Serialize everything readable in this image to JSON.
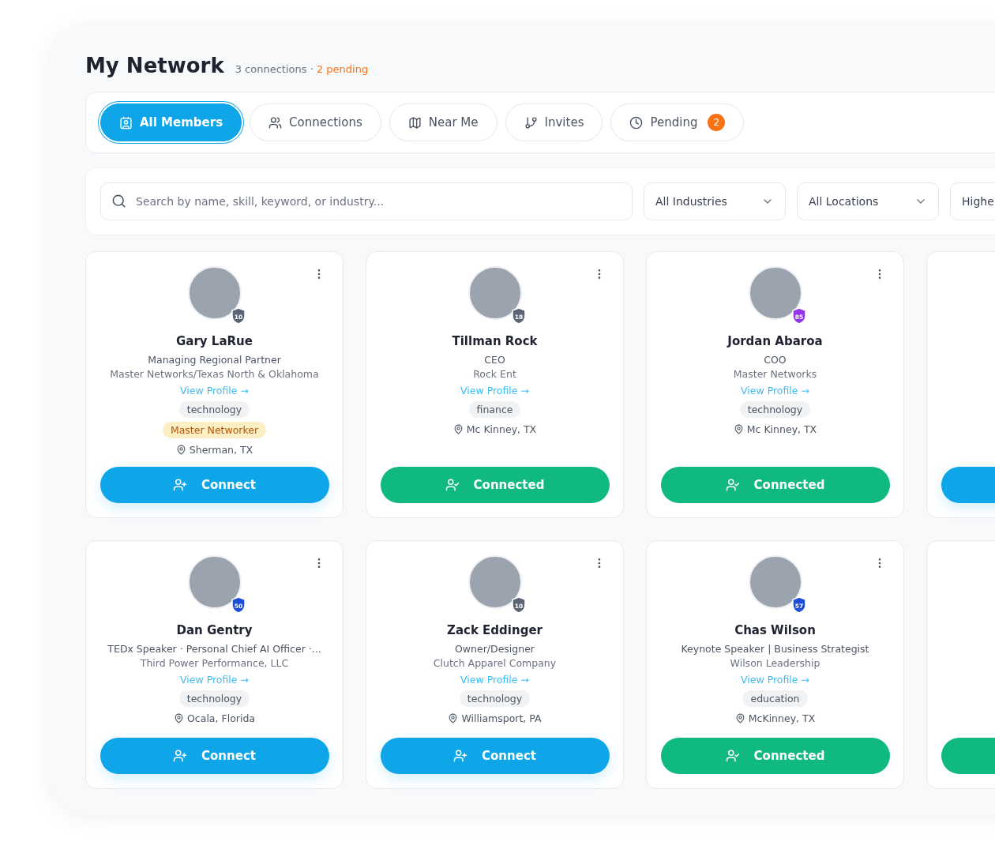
{
  "header": {
    "title": "My Network",
    "summary": "3 connections · ",
    "pending": "2 pending"
  },
  "tabs": [
    {
      "label": "All Members",
      "selected": true
    },
    {
      "label": "Connections",
      "selected": false
    },
    {
      "label": "Near Me",
      "selected": false
    },
    {
      "label": "Invites",
      "selected": false
    },
    {
      "label": "Pending",
      "selected": false,
      "count": "2"
    }
  ],
  "search": {
    "placeholder": "Search by name, skill, keyword, or industry..."
  },
  "filters": [
    {
      "label": "All Industries"
    },
    {
      "label": "All Locations"
    },
    {
      "label": "Highe"
    }
  ],
  "cards": [
    {
      "kind": "full",
      "name": "Gary LaRue",
      "level": "10",
      "color": "#5b6474",
      "title": "Managing Regional Partner",
      "company": "Master Networks/Texas North & Oklahoma",
      "link": "View Profile →",
      "tags": [
        {
          "label": "technology",
          "kind": "industry"
        },
        {
          "label": "Master Networker",
          "kind": "achievement"
        }
      ],
      "location": "Sherman, TX",
      "connected": false,
      "button": "Connect"
    },
    {
      "kind": "full",
      "name": "Tillman Rock",
      "level": "18",
      "color": "#5b6474",
      "title": "CEO",
      "company": "Rock Ent",
      "link": "View Profile →",
      "tags": [
        {
          "label": "finance",
          "kind": "industry"
        }
      ],
      "location": "Mc Kinney, TX",
      "connected": true,
      "button": "Connected"
    },
    {
      "kind": "full",
      "name": "Jordan Abaroa",
      "level": "85",
      "color": "#9333ea",
      "title": "COO",
      "company": "Master Networks",
      "link": "View Profile →",
      "tags": [
        {
          "label": "technology",
          "kind": "industry"
        }
      ],
      "location": "Mc Kinney, TX",
      "connected": true,
      "button": "Connected"
    },
    {
      "kind": "partial",
      "connected": false
    },
    {
      "kind": "full",
      "name": "Dan Gentry",
      "level": "50",
      "color": "#1d4ed8",
      "title": "TEDx Speaker · Personal Chief AI Officer ·...",
      "company": "Third Power Performance, LLC",
      "link": "View Profile →",
      "tags": [
        {
          "label": "technology",
          "kind": "industry"
        }
      ],
      "location": "Ocala, Florida",
      "connected": false,
      "button": "Connect"
    },
    {
      "kind": "full",
      "name": "Zack Eddinger",
      "level": "10",
      "color": "#5b6474",
      "title": "Owner/Designer",
      "company": "Clutch Apparel Company",
      "link": "View Profile →",
      "tags": [
        {
          "label": "technology",
          "kind": "industry"
        }
      ],
      "location": "Williamsport, PA",
      "connected": false,
      "button": "Connect"
    },
    {
      "kind": "full",
      "name": "Chas Wilson",
      "level": "57",
      "color": "#1d4ed8",
      "title": "Keynote Speaker | Business Strategist",
      "company": "Wilson Leadership",
      "link": "View Profile →",
      "tags": [
        {
          "label": "education",
          "kind": "industry"
        }
      ],
      "location": "McKinney, TX",
      "connected": true,
      "button": "Connected"
    },
    {
      "kind": "partial",
      "connected": true
    }
  ]
}
